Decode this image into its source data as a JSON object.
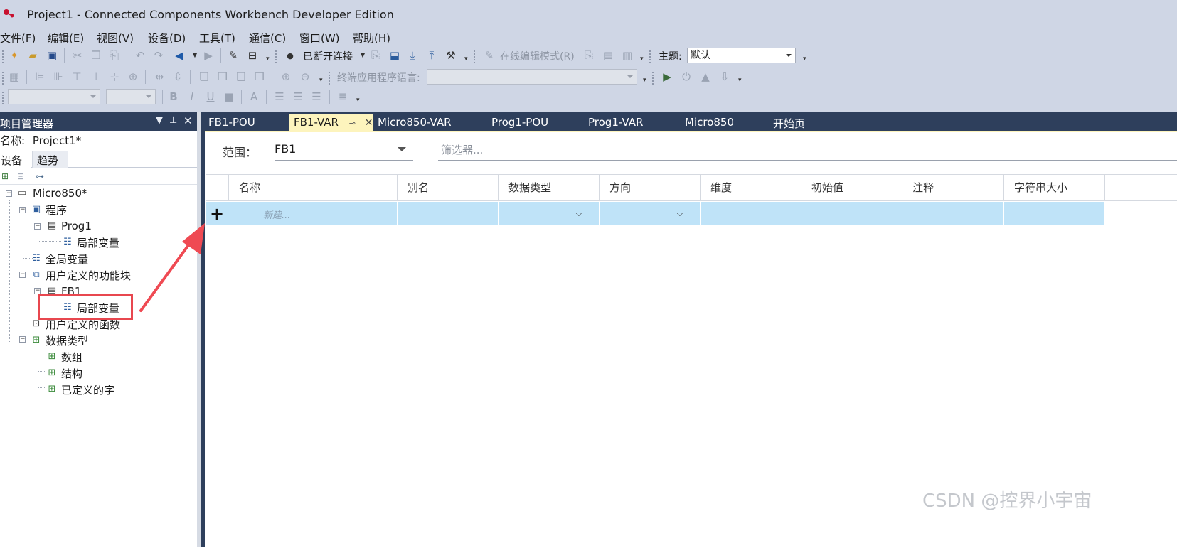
{
  "window": {
    "title": "Project1 - Connected Components Workbench Developer Edition"
  },
  "menu": {
    "items": [
      "文件(F)",
      "编辑(E)",
      "视图(V)",
      "设备(D)",
      "工具(T)",
      "通信(C)",
      "窗口(W)",
      "帮助(H)"
    ]
  },
  "toolbar": {
    "connection_status": "已断开连接",
    "online_edit_mode": "在线编辑模式(R)",
    "theme_label": "主题:",
    "theme_value": "默认",
    "terminal_language_label": "终端应用程序语言:",
    "terminal_language_value": ""
  },
  "project_panel": {
    "title": "项目管理器",
    "name_label": "名称:",
    "name_value": "Project1*",
    "tabs": [
      "设备",
      "趋势"
    ],
    "tree": [
      {
        "label": "Micro850*",
        "icon": "controller-icon"
      },
      {
        "label": "程序",
        "icon": "programs-folder-icon"
      },
      {
        "label": "Prog1",
        "icon": "program-icon"
      },
      {
        "label": "局部变量",
        "icon": "variable-list-icon"
      },
      {
        "label": "全局变量",
        "icon": "variable-list-icon"
      },
      {
        "label": "用户定义的功能块",
        "icon": "function-block-folder-icon"
      },
      {
        "label": "FB1",
        "icon": "function-block-icon"
      },
      {
        "label": "局部变量",
        "icon": "variable-list-icon"
      },
      {
        "label": "用户定义的函数",
        "icon": "function-folder-icon"
      },
      {
        "label": "数据类型",
        "icon": "datatype-folder-icon"
      },
      {
        "label": "数组",
        "icon": "datatype-icon"
      },
      {
        "label": "结构",
        "icon": "datatype-icon"
      },
      {
        "label": "已定义的字",
        "icon": "datatype-icon"
      }
    ]
  },
  "doc_tabs": [
    {
      "label": "FB1-POU"
    },
    {
      "label": "FB1-VAR"
    },
    {
      "label": "Micro850-VAR"
    },
    {
      "label": "Prog1-POU"
    },
    {
      "label": "Prog1-VAR"
    },
    {
      "label": "Micro850"
    },
    {
      "label": "开始页"
    }
  ],
  "editor": {
    "scope_label": "范围：",
    "scope_value": "FB1",
    "filter_placeholder": "筛选器...",
    "columns": [
      "名称",
      "别名",
      "数据类型",
      "方向",
      "维度",
      "初始值",
      "注释",
      "字符串大小"
    ],
    "new_row_placeholder": "新建..."
  },
  "colors": {
    "highlight_box": "#e8474f",
    "arrow": "#ef4a53",
    "active_tab": "#fdf4bd",
    "new_row": "#bfe3f8"
  },
  "watermark": "CSDN @控界小宇宙"
}
